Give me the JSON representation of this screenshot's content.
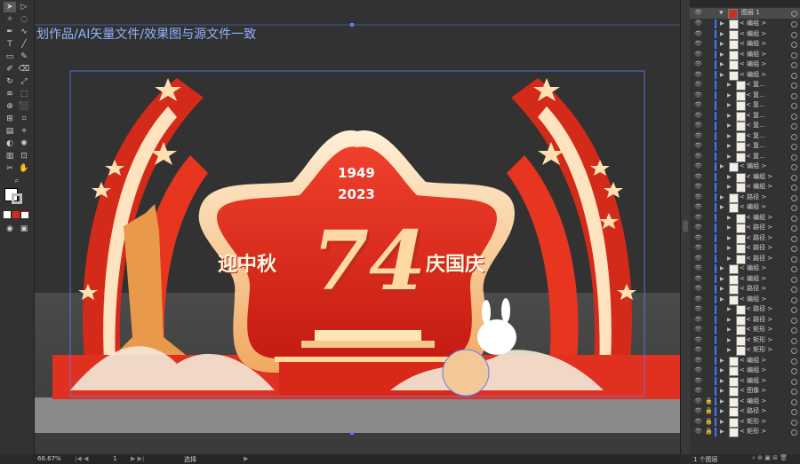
{
  "canvas": {
    "overlay_title": "划作品/AI矢量文件/效果图与源文件一致",
    "design": {
      "year_top": "1949",
      "year_bottom": "2023",
      "left_text": "迎中秋",
      "right_text": "庆国庆",
      "big_number": "74"
    }
  },
  "statusbar": {
    "zoom": "66.67%",
    "page": "1",
    "tool_name": "选择"
  },
  "layers_panel": {
    "top_layer": "图层 1",
    "rows": [
      "< 编组 >",
      "< 编组 >",
      "< 编组 >",
      "< 编组 >",
      "< 编组 >",
      "< 编组 >",
      "< 复...",
      "< 复...",
      "< 复...",
      "< 复...",
      "< 复...",
      "< 复...",
      "< 复...",
      "< 复...",
      "< 编组 >",
      "< 编组 >",
      "< 编组 >",
      "< 路径 >",
      "< 编组 >",
      "< 编组 >",
      "< 路径 >",
      "< 路径 >",
      "< 路径 >",
      "< 路径 >",
      "< 编组 >",
      "< 编组 >",
      "< 路径 >",
      "< 编组 >",
      "< 路径 >",
      "< 路径 >",
      "< 矩形 >",
      "< 矩形 >",
      "< 矩形 >",
      "< 编组 >",
      "< 编组 >",
      "< 编组 >",
      "< 图像 >",
      "< 编组 >",
      "< 路径 >",
      "< 矩形 >",
      "< 矩形 >"
    ],
    "footer": "1 个图层"
  },
  "colors": {
    "red": "#e8301f",
    "deep_red": "#b3170f",
    "gold": "#f0b870",
    "cream": "#fff1dc",
    "selection_blue": "#5a7dff"
  }
}
